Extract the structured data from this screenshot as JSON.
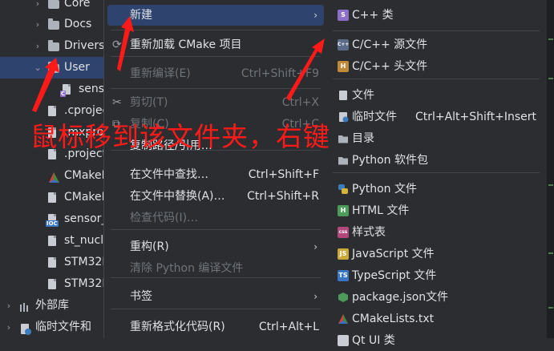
{
  "project_tree": [
    {
      "label": "Core",
      "indent": 1,
      "type": "folder",
      "chevron": "›"
    },
    {
      "label": "Docs",
      "indent": 1,
      "type": "folder",
      "chevron": "›"
    },
    {
      "label": "Drivers",
      "indent": 1,
      "type": "folder",
      "chevron": "›"
    },
    {
      "label": "User",
      "indent": 1,
      "type": "folder",
      "chevron": "⌄",
      "selected": true
    },
    {
      "label": "sensor",
      "indent": 2,
      "type": "c-file",
      "badge": "C"
    },
    {
      "label": ".cprojec",
      "indent": 1,
      "type": "file"
    },
    {
      "label": ".mxproj",
      "indent": 1,
      "type": "file"
    },
    {
      "label": ".project",
      "indent": 1,
      "type": "file"
    },
    {
      "label": "CMakeL",
      "indent": 1,
      "type": "cmake"
    },
    {
      "label": "CMakeL",
      "indent": 1,
      "type": "file"
    },
    {
      "label": "sensor_",
      "indent": 1,
      "type": "ioc",
      "badge": "IOC"
    },
    {
      "label": "st_nucl",
      "indent": 1,
      "type": "file"
    },
    {
      "label": "STM32I",
      "indent": 1,
      "type": "file"
    },
    {
      "label": "STM32I",
      "indent": 1,
      "type": "file"
    },
    {
      "label": "外部库",
      "indent": 0,
      "type": "library",
      "chevron": "›"
    },
    {
      "label": "临时文件和",
      "indent": 0,
      "type": "scratch",
      "chevron": "›"
    }
  ],
  "context_menu": [
    {
      "label": "新建",
      "shortcut": "",
      "submenu": true,
      "active": true,
      "disabled": false,
      "icon": ""
    },
    {
      "sep": true
    },
    {
      "label": "重新加载 CMake 项目",
      "shortcut": "",
      "submenu": false,
      "disabled": false,
      "icon": "⟳"
    },
    {
      "sep": true
    },
    {
      "label": "重新编译(E)",
      "shortcut": "Ctrl+Shift+F9",
      "submenu": false,
      "disabled": true,
      "icon": ""
    },
    {
      "sep": true
    },
    {
      "label": "剪切(T)",
      "shortcut": "Ctrl+X",
      "submenu": false,
      "disabled": true,
      "icon": "✂"
    },
    {
      "label": "复制(C)",
      "shortcut": "Ctrl+C",
      "submenu": false,
      "disabled": true,
      "icon": "⧉"
    },
    {
      "label": "复制路径/引用…",
      "shortcut": "",
      "submenu": false,
      "disabled": false,
      "icon": ""
    },
    {
      "sep": true
    },
    {
      "label": "在文件中查找…",
      "shortcut": "Ctrl+Shift+F",
      "submenu": false,
      "disabled": false,
      "icon": ""
    },
    {
      "label": "在文件中替换(A)…",
      "shortcut": "Ctrl+Shift+R",
      "submenu": false,
      "disabled": false,
      "icon": ""
    },
    {
      "label": "检查代码(I)…",
      "shortcut": "",
      "submenu": false,
      "disabled": true,
      "icon": ""
    },
    {
      "sep": true
    },
    {
      "label": "重构(R)",
      "shortcut": "",
      "submenu": true,
      "disabled": false,
      "icon": ""
    },
    {
      "label": "清除 Python 编译文件",
      "shortcut": "",
      "submenu": false,
      "disabled": true,
      "icon": ""
    },
    {
      "sep": true
    },
    {
      "label": "书签",
      "shortcut": "",
      "submenu": true,
      "disabled": false,
      "icon": ""
    },
    {
      "sep": true
    },
    {
      "label": "重新格式化代码(R)",
      "shortcut": "Ctrl+Alt+L",
      "submenu": false,
      "disabled": false,
      "icon": ""
    }
  ],
  "new_submenu": [
    {
      "label": "C++ 类",
      "icon": "S",
      "color": "#8b6fc8"
    },
    {
      "sep": true
    },
    {
      "label": "C/C++ 源文件",
      "icon": "C++",
      "color": "#5b6b8a"
    },
    {
      "label": "C/C++ 头文件",
      "icon": "H",
      "color": "#c08a3a"
    },
    {
      "sep": true
    },
    {
      "label": "文件",
      "icon": "file",
      "color": "#c9ccd2"
    },
    {
      "label": "临时文件",
      "shortcut": "Ctrl+Alt+Shift+Insert",
      "icon": "scratch",
      "color": "#c9ccd2"
    },
    {
      "label": "目录",
      "icon": "folder",
      "color": "#aeb3bb"
    },
    {
      "label": "Python 软件包",
      "icon": "folder",
      "color": "#aeb3bb"
    },
    {
      "sep": true
    },
    {
      "label": "Python 文件",
      "icon": "py",
      "color": "#3d7bbf"
    },
    {
      "label": "HTML 文件",
      "icon": "H",
      "color": "#4e9a5b"
    },
    {
      "label": "样式表",
      "icon": "css",
      "color": "#b2487a"
    },
    {
      "label": "JavaScript 文件",
      "icon": "JS",
      "color": "#c9a93a"
    },
    {
      "label": "TypeScript 文件",
      "icon": "TS",
      "color": "#3b76c4"
    },
    {
      "label": "package.json文件",
      "icon": "pkg",
      "color": "#4e9a5b"
    },
    {
      "label": "CMakeLists.txt",
      "icon": "cmake",
      "color": "#d04040"
    },
    {
      "label": "Qt UI 类",
      "icon": "qt",
      "color": "#c9ccd2"
    }
  ],
  "annotation": {
    "text": "鼠标移到该文件夹，右键",
    "color": "#ff1a1a"
  }
}
